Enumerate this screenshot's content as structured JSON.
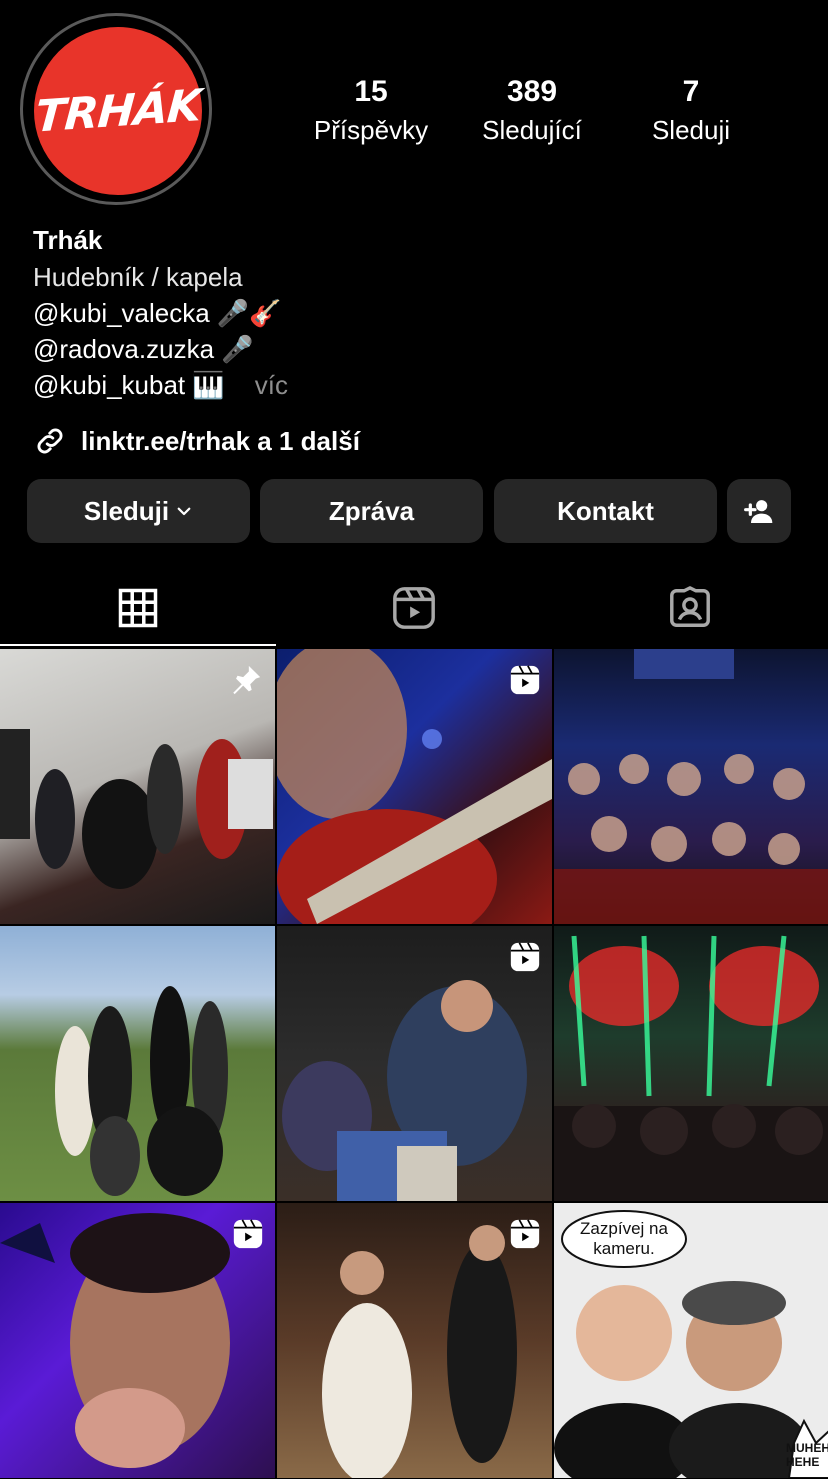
{
  "profile": {
    "avatar_text": "TRHÁK",
    "stats": [
      {
        "value": "15",
        "label": "Příspěvky"
      },
      {
        "value": "389",
        "label": "Sledující"
      },
      {
        "value": "7",
        "label": "Sleduji"
      }
    ],
    "name": "Trhák",
    "category": "Hudebník / kapela",
    "bio_lines": [
      "@kubi_valecka 🎤🎸",
      "@radova.zuzka 🎤",
      "@kubi_kubat 🎹"
    ],
    "more": "víc",
    "link": "linktr.ee/trhak a 1 další"
  },
  "actions": {
    "follow": "Sleduji",
    "message": "Zpráva",
    "contact": "Kontakt"
  },
  "tabs": [
    {
      "name": "grid-icon",
      "active": true
    },
    {
      "name": "reels-icon",
      "active": false
    },
    {
      "name": "tagged-icon",
      "active": false
    }
  ],
  "posts": [
    {
      "type": "photo",
      "pinned": true
    },
    {
      "type": "reel"
    },
    {
      "type": "photo"
    },
    {
      "type": "photo"
    },
    {
      "type": "reel"
    },
    {
      "type": "photo"
    },
    {
      "type": "reel"
    },
    {
      "type": "reel"
    },
    {
      "type": "photo",
      "bubble_text": "Zazpívej na kameru.",
      "burst_text": "MUHEHE HEHE"
    }
  ],
  "colors": {
    "accent": "#e8342a",
    "button_bg": "#262626",
    "muted": "#8e8e8e"
  }
}
